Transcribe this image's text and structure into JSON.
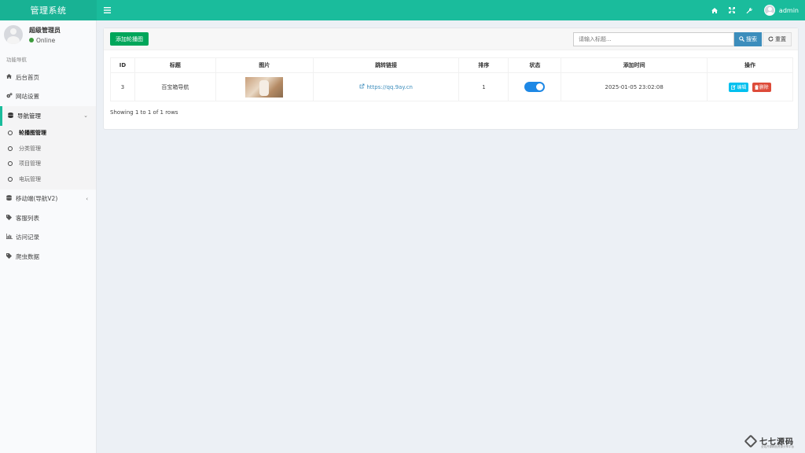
{
  "header": {
    "title": "管理系统",
    "menu_icon": "bars-icon",
    "icons": [
      "home-icon",
      "expand-icon",
      "wrench-icon"
    ],
    "username": "admin"
  },
  "sidebar": {
    "user": {
      "name": "超级管理员",
      "status": "Online"
    },
    "nav_header": "功能导航",
    "items": [
      {
        "label": "后台首页",
        "icon": "home-icon"
      },
      {
        "label": "网站设置",
        "icon": "cogs-icon"
      },
      {
        "label": "导航管理",
        "icon": "database-icon",
        "caret": "⌄",
        "active": true
      },
      {
        "label": "移动端(导航V2)",
        "icon": "database-icon",
        "caret": "‹"
      },
      {
        "label": "客服列表",
        "icon": "tags-icon"
      },
      {
        "label": "访问记录",
        "icon": "bar-chart-icon"
      },
      {
        "label": "爬虫数据",
        "icon": "tags-icon"
      }
    ],
    "sub_items": [
      {
        "label": "轮播图管理",
        "current": true
      },
      {
        "label": "分类管理"
      },
      {
        "label": "项目管理"
      },
      {
        "label": "电玩管理"
      }
    ]
  },
  "toolbar": {
    "add_label": "添加轮播图",
    "search_placeholder": "请输入标题...",
    "search_label": "搜索",
    "reset_label": "重置"
  },
  "table": {
    "headers": [
      "ID",
      "标题",
      "图片",
      "跳转链接",
      "排序",
      "状态",
      "添加时间",
      "操作"
    ],
    "rows": [
      {
        "id": "3",
        "title": "百宝箱导航",
        "link": "https://qq.9ay.cn",
        "sort": "1",
        "status": "on",
        "time": "2025-01-05 23:02:08",
        "edit_label": "编辑",
        "delete_label": "删除"
      }
    ],
    "footer": "Showing 1 to 1 of 1 rows"
  },
  "watermark": {
    "text": "七七源码",
    "subtext": "全站开源精品资源分享平台"
  },
  "colors": {
    "header": "#1abc9c",
    "add_button": "#00a65a",
    "search_button": "#3c8dbc",
    "switch_on": "#1e88e5",
    "edit": "#00c0ef",
    "delete": "#dd4b39"
  }
}
